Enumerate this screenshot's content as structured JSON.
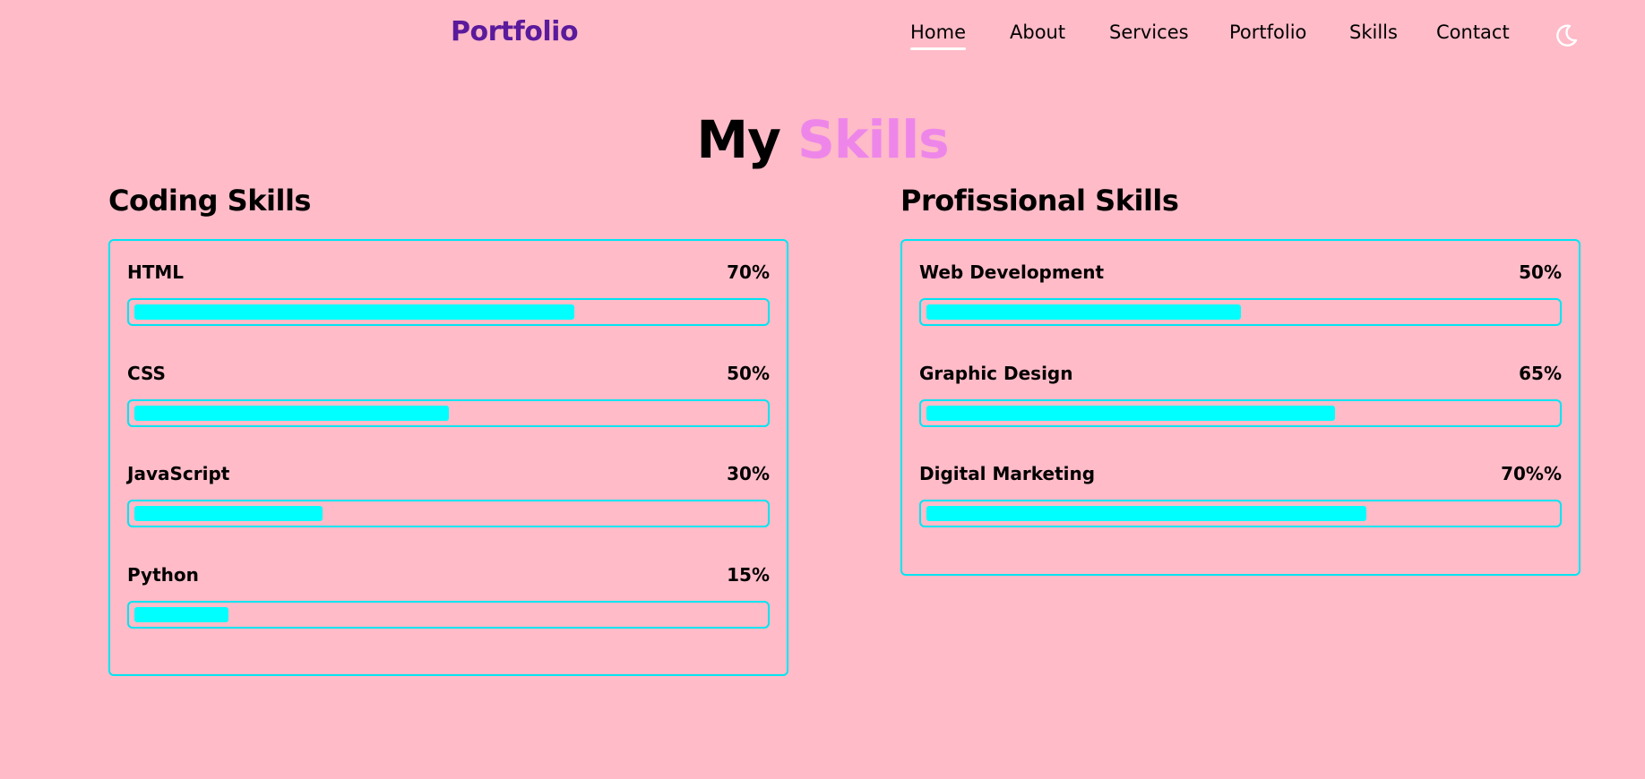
{
  "header": {
    "logo": "Portfolio",
    "nav": [
      {
        "label": "Home",
        "active": true
      },
      {
        "label": "About",
        "active": false
      },
      {
        "label": "Services",
        "active": false
      },
      {
        "label": "Portfolio",
        "active": false
      },
      {
        "label": "Skills",
        "active": false
      },
      {
        "label": "Contact",
        "active": false
      }
    ],
    "theme_icon": "moon-icon"
  },
  "section": {
    "title_part1": "My",
    "title_part2": "Skills"
  },
  "coding": {
    "title": "Coding Skills",
    "skills": [
      {
        "name": "HTML",
        "percent_label": "70%",
        "level": 70
      },
      {
        "name": "CSS",
        "percent_label": "50%",
        "level": 50
      },
      {
        "name": "JavaScript",
        "percent_label": "30%",
        "level": 30
      },
      {
        "name": "Python",
        "percent_label": "15%",
        "level": 15
      }
    ]
  },
  "professional": {
    "title": "Profissional Skills",
    "skills": [
      {
        "name": "Web Development",
        "percent_label": "50%",
        "level": 50
      },
      {
        "name": "Graphic Design",
        "percent_label": "65%",
        "level": 65
      },
      {
        "name": "Digital Marketing",
        "percent_label": "70%%",
        "level": 70
      }
    ]
  },
  "colors": {
    "background": "#ffbbc8",
    "logo": "#5b1a9c",
    "accent": "#ee86ea",
    "bar_border": "#00e5f2",
    "bar_fill": "#00ffff"
  }
}
